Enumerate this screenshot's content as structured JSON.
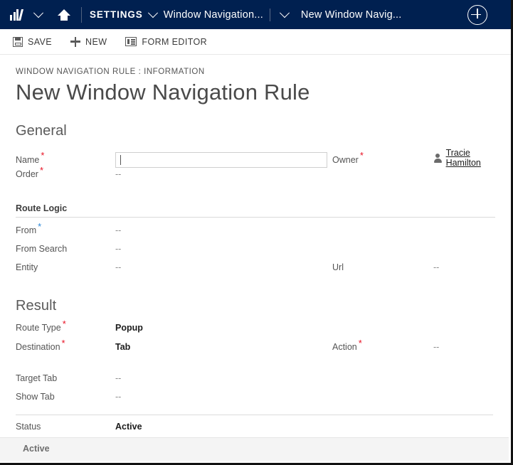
{
  "navbar": {
    "logo_icon": "dynamics-logo-icon",
    "logo_chevron_icon": "chevron-down-icon",
    "home_icon": "home-icon",
    "settings_label": "SETTINGS",
    "settings_chevron_icon": "chevron-down-icon",
    "breadcrumb_entity": "Window Navigation...",
    "breadcrumb_chevron_icon": "chevron-down-icon",
    "breadcrumb_record": "New Window Navig...",
    "quick_create_icon": "circle-plus-icon",
    "background_color": "#002050"
  },
  "commandbar": {
    "save_label": "SAVE",
    "save_icon": "floppy-disk-icon",
    "new_label": "NEW",
    "new_icon": "plus-icon",
    "form_editor_label": "FORM EDITOR",
    "form_editor_icon": "form-layout-icon"
  },
  "header": {
    "breadcrumb": "WINDOW NAVIGATION RULE : INFORMATION",
    "title": "New Window Navigation Rule"
  },
  "general": {
    "section_title": "General",
    "name_label": "Name",
    "name_required": "*",
    "name_value": "",
    "name_placeholder": "",
    "order_label": "Order",
    "order_required": "*",
    "order_value": "--",
    "owner_label": "Owner",
    "owner_required": "*",
    "owner_value": "Tracie Hamilton",
    "owner_icon": "person-icon"
  },
  "route_logic": {
    "section_title": "Route Logic",
    "from_label": "From",
    "from_recommended": "*",
    "from_value": "--",
    "from_search_label": "From Search",
    "from_search_value": "--",
    "entity_label": "Entity",
    "entity_value": "--",
    "url_label": "Url",
    "url_value": "--"
  },
  "result": {
    "section_title": "Result",
    "route_type_label": "Route Type",
    "route_type_required": "*",
    "route_type_value": "Popup",
    "destination_label": "Destination",
    "destination_required": "*",
    "destination_value": "Tab",
    "action_label": "Action",
    "action_required": "*",
    "action_value": "--",
    "target_tab_label": "Target Tab",
    "target_tab_value": "--",
    "show_tab_label": "Show Tab",
    "show_tab_value": "--"
  },
  "status": {
    "label": "Status",
    "value": "Active",
    "footer_value": "Active"
  },
  "colors": {
    "nav_background": "#002050",
    "required_marker": "#e81123",
    "recommended_marker": "#2b88d8",
    "footer_background": "#f4f4f4"
  }
}
